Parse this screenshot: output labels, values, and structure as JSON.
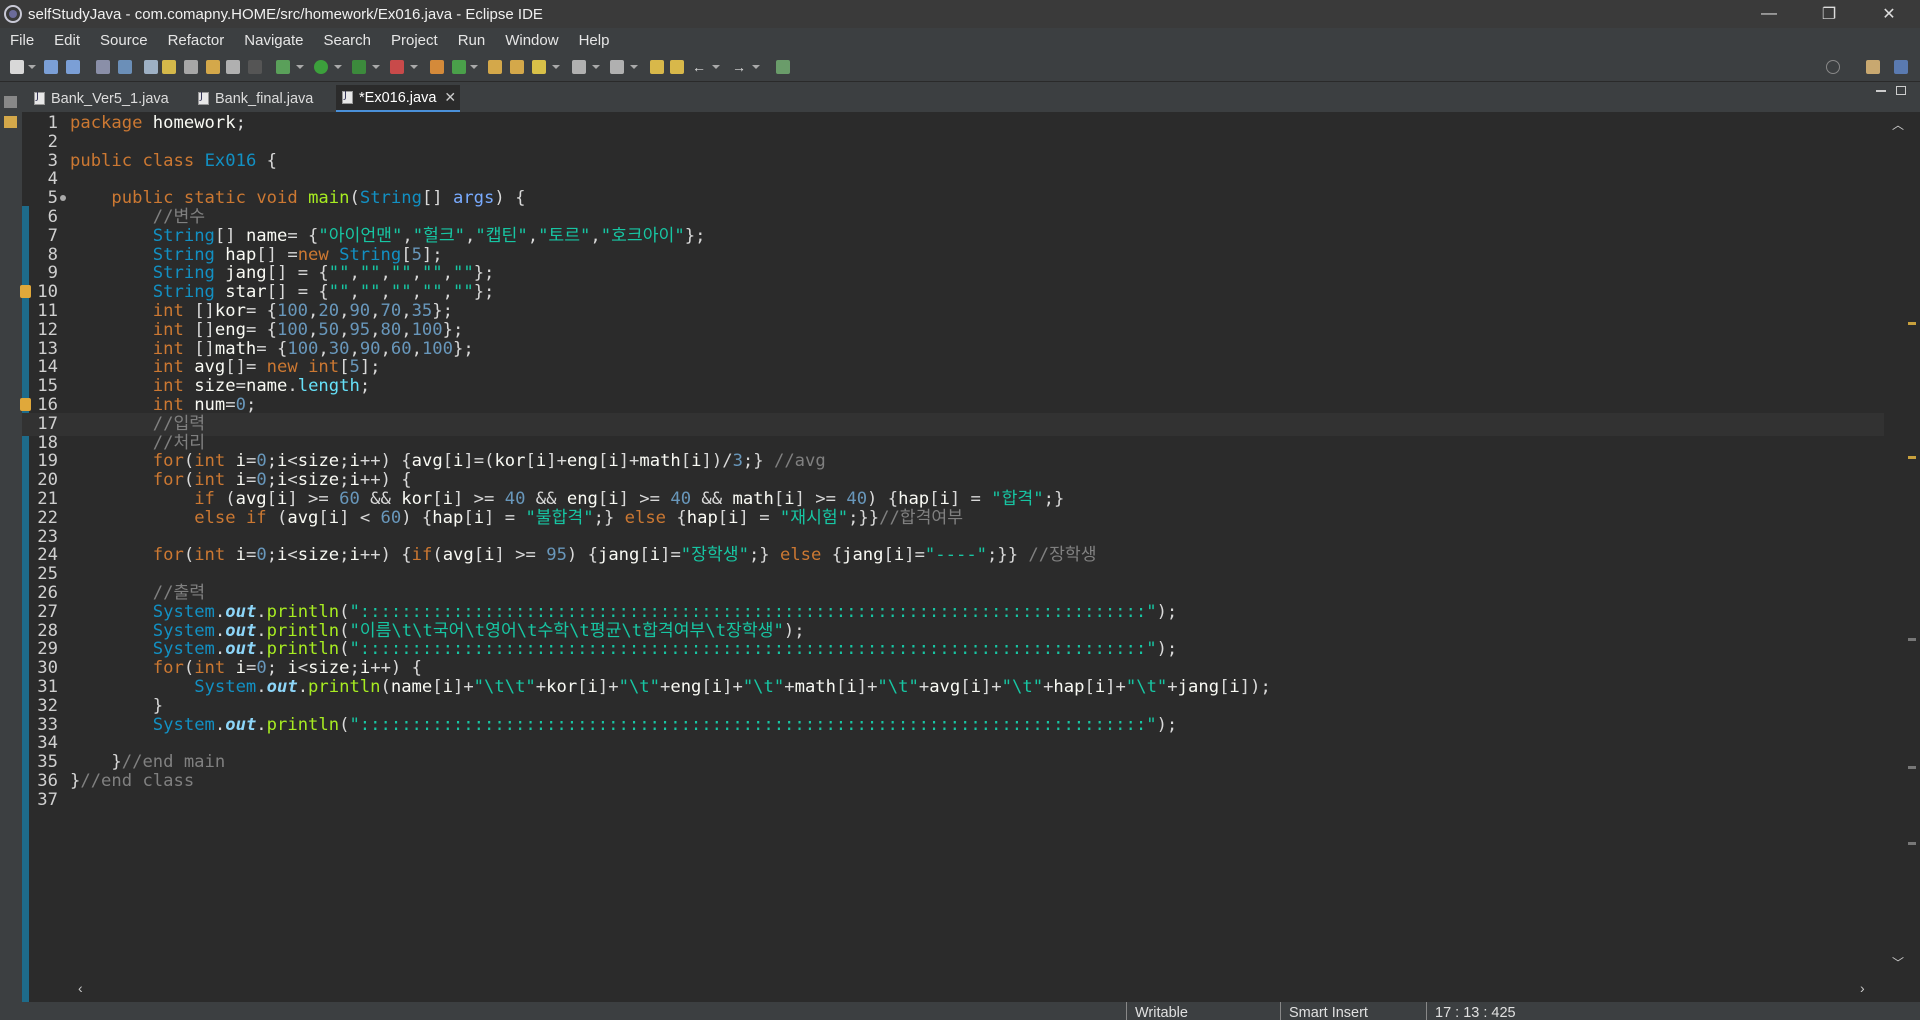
{
  "window": {
    "title": "selfStudyJava - com.comapny.HOME/src/homework/Ex016.java - Eclipse IDE",
    "minimize": "—",
    "maximize": "❐",
    "close": "✕"
  },
  "menu": [
    "File",
    "Edit",
    "Source",
    "Refactor",
    "Navigate",
    "Search",
    "Project",
    "Run",
    "Window",
    "Help"
  ],
  "tabs": [
    {
      "label": "Bank_Ver5_1.java",
      "active": false
    },
    {
      "label": "Bank_final.java",
      "active": false
    },
    {
      "label": "*Ex016.java",
      "active": true,
      "close": "✕"
    }
  ],
  "editor": {
    "file": "Ex016.java",
    "current_line": 17
  },
  "code_lines": [
    "package homework;",
    "",
    "public class Ex016 {",
    "",
    "    public static void main(String[] args) {",
    "        //변수",
    "        String[] name= {\"아이언맨\",\"헐크\",\"캡틴\",\"토르\",\"호크아이\"};",
    "        String hap[] =new String[5];",
    "        String jang[] = {\"\",\"\",\"\",\"\",\"\"};",
    "        String star[] = {\"\",\"\",\"\",\"\",\"\"};",
    "        int []kor= {100,20,90,70,35};",
    "        int []eng= {100,50,95,80,100};",
    "        int []math= {100,30,90,60,100};",
    "        int avg[]= new int[5];",
    "        int size=name.length;",
    "        int num=0;",
    "        //입력",
    "        //처리",
    "        for(int i=0;i<size;i++) {avg[i]=(kor[i]+eng[i]+math[i])/3;} //avg",
    "        for(int i=0;i<size;i++) {",
    "            if (avg[i] >= 60 && kor[i] >= 40 && eng[i] >= 40 && math[i] >= 40) {hap[i] = \"합격\";}",
    "            else if (avg[i] < 60) {hap[i] = \"불합격\";} else {hap[i] = \"재시험\";}}//합격여부",
    "",
    "        for(int i=0;i<size;i++) {if(avg[i] >= 95) {jang[i]=\"장학생\";} else {jang[i]=\"----\";}} //장학생",
    "",
    "        //출력",
    "        System.out.println(\"::::::::::::::::::::::::::::::::::::::::::::::::::::::::::::::::::::::::::::\");",
    "        System.out.println(\"이름\\t\\t국어\\t영어\\t수학\\t평균\\t합격여부\\t장학생\");",
    "        System.out.println(\"::::::::::::::::::::::::::::::::::::::::::::::::::::::::::::::::::::::::::::\");",
    "        for(int i=0; i<size;i++) {",
    "            System.out.println(name[i]+\"\\t\\t\"+kor[i]+\"\\t\"+eng[i]+\"\\t\"+math[i]+\"\\t\"+avg[i]+\"\\t\"+hap[i]+\"\\t\"+jang[i]);",
    "        }",
    "        System.out.println(\"::::::::::::::::::::::::::::::::::::::::::::::::::::::::::::::::::::::::::::\");",
    "",
    "    }//end main",
    "}//end class",
    ""
  ],
  "status": {
    "mode": "Writable",
    "insert": "Smart Insert",
    "position": "17 : 13 : 425"
  },
  "colors": {
    "keyword": "#cc7832",
    "type": "#1290c3",
    "string": "#17c6a3",
    "comment": "#808080",
    "number": "#6897bb",
    "method": "#a7ec21"
  }
}
